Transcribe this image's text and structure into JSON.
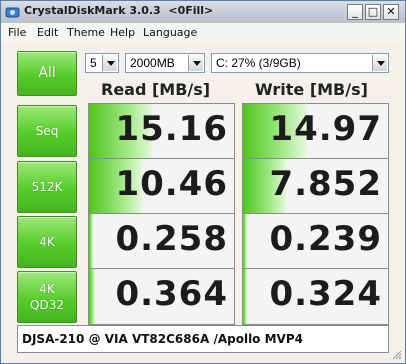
{
  "window": {
    "title": "CrystalDiskMark 3.0.3  <0Fill>",
    "minimize_glyph": "_",
    "maximize_glyph": "□",
    "close_glyph": "✕"
  },
  "menu": {
    "items": [
      {
        "label": "File"
      },
      {
        "label": "Edit"
      },
      {
        "label": "Theme"
      },
      {
        "label": "Help"
      },
      {
        "label": "Language"
      }
    ]
  },
  "controls": {
    "all_button": "All",
    "count_select": "5",
    "size_select": "2000MB",
    "drive_select": "C: 27% (3/9GB)"
  },
  "headers": {
    "read": "Read [MB/s]",
    "write": "Write [MB/s]"
  },
  "tests": [
    {
      "label_lines": [
        "Seq"
      ],
      "read": "15.16",
      "write": "14.97",
      "read_fill": 0.44,
      "write_fill": 0.44
    },
    {
      "label_lines": [
        "512K"
      ],
      "read": "10.46",
      "write": "7.852",
      "read_fill": 0.37,
      "write_fill": 0.3
    },
    {
      "label_lines": [
        "4K"
      ],
      "read": "0.258",
      "write": "0.239",
      "read_fill": 0.03,
      "write_fill": 0.03
    },
    {
      "label_lines": [
        "4K",
        "QD32"
      ],
      "read": "0.364",
      "write": "0.324",
      "read_fill": 0.04,
      "write_fill": 0.03
    }
  ],
  "comment": "DJSA-210 @ VIA VT82C686A /Apollo MVP4",
  "colors": {
    "button_green": "#55cc2a",
    "bar_green": "#4fc41e"
  }
}
